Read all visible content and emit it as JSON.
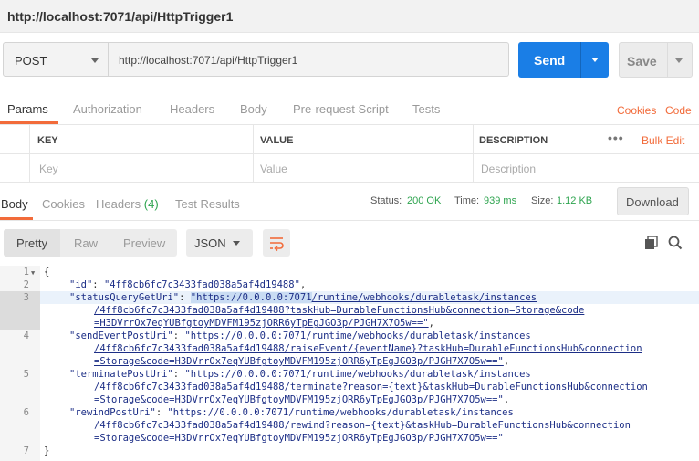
{
  "window": {
    "title": "http://localhost:7071/api/HttpTrigger1"
  },
  "request": {
    "method": "POST",
    "url": "http://localhost:7071/api/HttpTrigger1",
    "send_label": "Send",
    "save_label": "Save"
  },
  "request_tabs": {
    "items": [
      "Params",
      "Authorization",
      "Headers",
      "Body",
      "Pre-request Script",
      "Tests"
    ],
    "active": "Params",
    "cookies_link": "Cookies",
    "code_link": "Code"
  },
  "params_table": {
    "headers": [
      "KEY",
      "VALUE",
      "DESCRIPTION"
    ],
    "placeholders": [
      "Key",
      "Value",
      "Description"
    ],
    "more_label": "•••",
    "bulk_edit_label": "Bulk Edit"
  },
  "response_tabs": {
    "items": [
      "Body",
      "Cookies",
      "Headers",
      "Test Results"
    ],
    "headers_count": "(4)",
    "active": "Body"
  },
  "response_meta": {
    "status_label": "Status:",
    "status_value": "200 OK",
    "time_label": "Time:",
    "time_value": "939 ms",
    "size_label": "Size:",
    "size_value": "1.12 KB",
    "download_label": "Download",
    "status_color": "#2ea44f"
  },
  "format_bar": {
    "modes": [
      "Pretty",
      "Raw",
      "Preview"
    ],
    "active_mode": "Pretty",
    "language": "JSON",
    "icons": [
      "wrap-lines-icon",
      "copy-icon",
      "search-icon"
    ]
  },
  "code": {
    "line_numbers": [
      "1",
      "2",
      "3",
      "4",
      "5",
      "6",
      "7"
    ],
    "highlighted_line": "3",
    "open_brace": "{",
    "close_brace": "}",
    "fields": {
      "id_key": "\"id\"",
      "id_value": "\"4ff8cb6fc7c3433fad038a5af4d19488\"",
      "status_key": "\"statusQueryGetUri\"",
      "status_sel": "\"https://0.0.0.0:7071",
      "status_rest_1": "/runtime/webhooks/durabletask/instances",
      "status_rest_2": "/4ff8cb6fc7c3433fad038a5af4d19488?taskHub=DurableFunctionsHub&connection=Storage&code",
      "status_rest_3": "=H3DVrrOx7eqYUBfgtoyMDVFM195zjORR6yTpEgJGO3p/PJGH7X7O5w==\"",
      "send_key": "\"sendEventPostUri\"",
      "send_1": "\"https://0.0.0.0:7071/runtime/webhooks/durabletask/instances",
      "send_2": "/4ff8cb6fc7c3433fad038a5af4d19488/raiseEvent/{eventName}?taskHub=DurableFunctionsHub&connection",
      "send_3": "=Storage&code=H3DVrrOx7eqYUBfgtoyMDVFM195zjORR6yTpEgJGO3p/PJGH7X7O5w==\"",
      "term_key": "\"terminatePostUri\"",
      "term_1": "\"https://0.0.0.0:7071/runtime/webhooks/durabletask/instances",
      "term_2": "/4ff8cb6fc7c3433fad038a5af4d19488/terminate?reason={text}&taskHub=DurableFunctionsHub&connection",
      "term_3": "=Storage&code=H3DVrrOx7eqYUBfgtoyMDVFM195zjORR6yTpEgJGO3p/PJGH7X7O5w==\"",
      "rewind_key": "\"rewindPostUri\"",
      "rewind_1": "\"https://0.0.0.0:7071/runtime/webhooks/durabletask/instances",
      "rewind_2": "/4ff8cb6fc7c3433fad038a5af4d19488/rewind?reason={text}&taskHub=DurableFunctionsHub&connection",
      "rewind_3": "=Storage&code=H3DVrrOx7eqYUBfgtoyMDVFM195zjORR6yTpEgJGO3p/PJGH7X7O5w==\""
    }
  },
  "colors": {
    "accent": "#f26b3a",
    "primary": "#1a7ee6"
  }
}
